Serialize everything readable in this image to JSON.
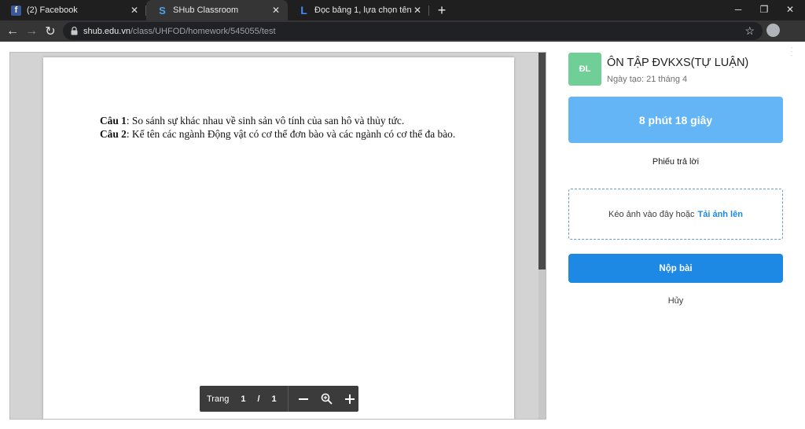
{
  "browser": {
    "tabs": [
      {
        "title": "(2) Facebook",
        "icon": "facebook-icon"
      },
      {
        "title": "SHub Classroom",
        "icon": "shub-icon"
      },
      {
        "title": "Đọc bảng 1, lựa chọn tên ngành",
        "icon": "l-logo-icon"
      }
    ],
    "url_host": "shub.edu.vn",
    "url_path": "/class/UHFOD/homework/545055/test"
  },
  "document": {
    "q1_label": "Câu 1",
    "q1_text": ": So sánh sự khác nhau về sinh sản vô tính của san hô và thủy tức.",
    "q2_label": "Câu 2",
    "q2_text": ": Kể tên các ngành Động vật có cơ thể đơn bào và các ngành có cơ thể đa bào."
  },
  "pdf_toolbar": {
    "page_label": "Trang",
    "current_page": "1",
    "separator": "/",
    "total_pages": "1"
  },
  "homework": {
    "initials": "ĐL",
    "title": "ÔN TẬP ĐVKXS(TỰ LUẬN)",
    "created": "Ngày tạo: 21 tháng 4",
    "timer": "8 phút 18 giây",
    "answer_sheet": "Phiếu trả lời",
    "dropzone_text": "Kéo ảnh vào đây hoặc",
    "upload_link": "Tải ảnh lên",
    "submit_label": "Nộp bài",
    "cancel_label": "Hủy"
  },
  "colors": {
    "timer_bg": "#64b5f6",
    "submit_bg": "#1e88e5",
    "initials_bg": "#6fcf97"
  }
}
